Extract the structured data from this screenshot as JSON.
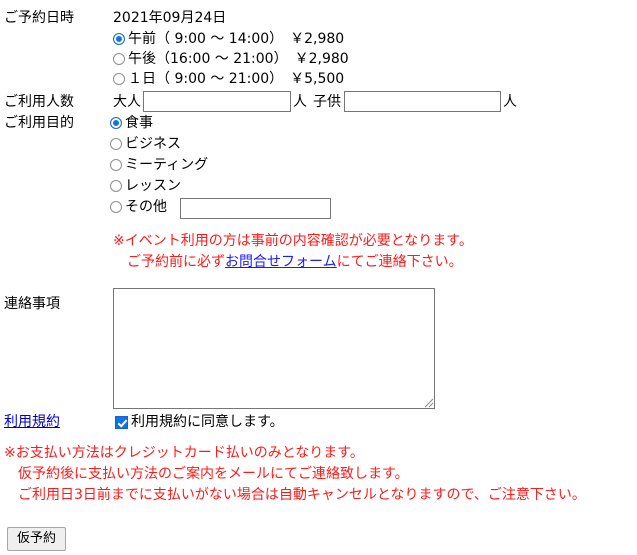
{
  "form": {
    "datetime": {
      "label": "ご予約日時",
      "date": "2021年09月24日",
      "options": [
        {
          "text": "午前（ 9:00 ～ 14:00）",
          "price": "￥2,980",
          "selected": true
        },
        {
          "text": "午後（16:00 ～ 21:00）",
          "price": "￥2,980",
          "selected": false
        },
        {
          "text": "１日（ 9:00 ～ 21:00）",
          "price": "￥5,500",
          "selected": false
        }
      ]
    },
    "guests": {
      "label": "ご利用人数",
      "adult_label": "大人",
      "adult_value": "",
      "adult_unit": "人",
      "child_label": "子供",
      "child_value": "",
      "child_unit": "人"
    },
    "purpose": {
      "label": "ご利用目的",
      "options": [
        {
          "text": "食事",
          "selected": true
        },
        {
          "text": "ビジネス",
          "selected": false
        },
        {
          "text": "ミーティング",
          "selected": false
        },
        {
          "text": "レッスン",
          "selected": false
        },
        {
          "text": "その他",
          "selected": false,
          "has_input": true,
          "input_value": ""
        }
      ]
    },
    "event_notice": {
      "line1": "※イベント利用の方は事前の内容確認が必要となります。",
      "line2_before": "ご予約前に必ず",
      "line2_link": "お問合せフォーム",
      "line2_after": "にてご連絡下さい。"
    },
    "message": {
      "label": "連絡事項",
      "value": ""
    },
    "terms": {
      "label": "利用規約",
      "agree_text": "利用規約に同意します。",
      "checked": true
    },
    "payment_notice": {
      "line1": "※お支払い方法はクレジットカード払いのみとなります。",
      "line2": "仮予約後に支払い方法のご案内をメールにてご連絡致します。",
      "line3": "ご利用日3日前までに支払いがない場合は自動キャンセルとなりますので、ご注意下さい。"
    },
    "submit": {
      "label": "仮予約"
    }
  },
  "colors": {
    "notice_red": "#ff1a1a",
    "link_blue": "#0000cd",
    "accent_blue": "#1273e6"
  }
}
